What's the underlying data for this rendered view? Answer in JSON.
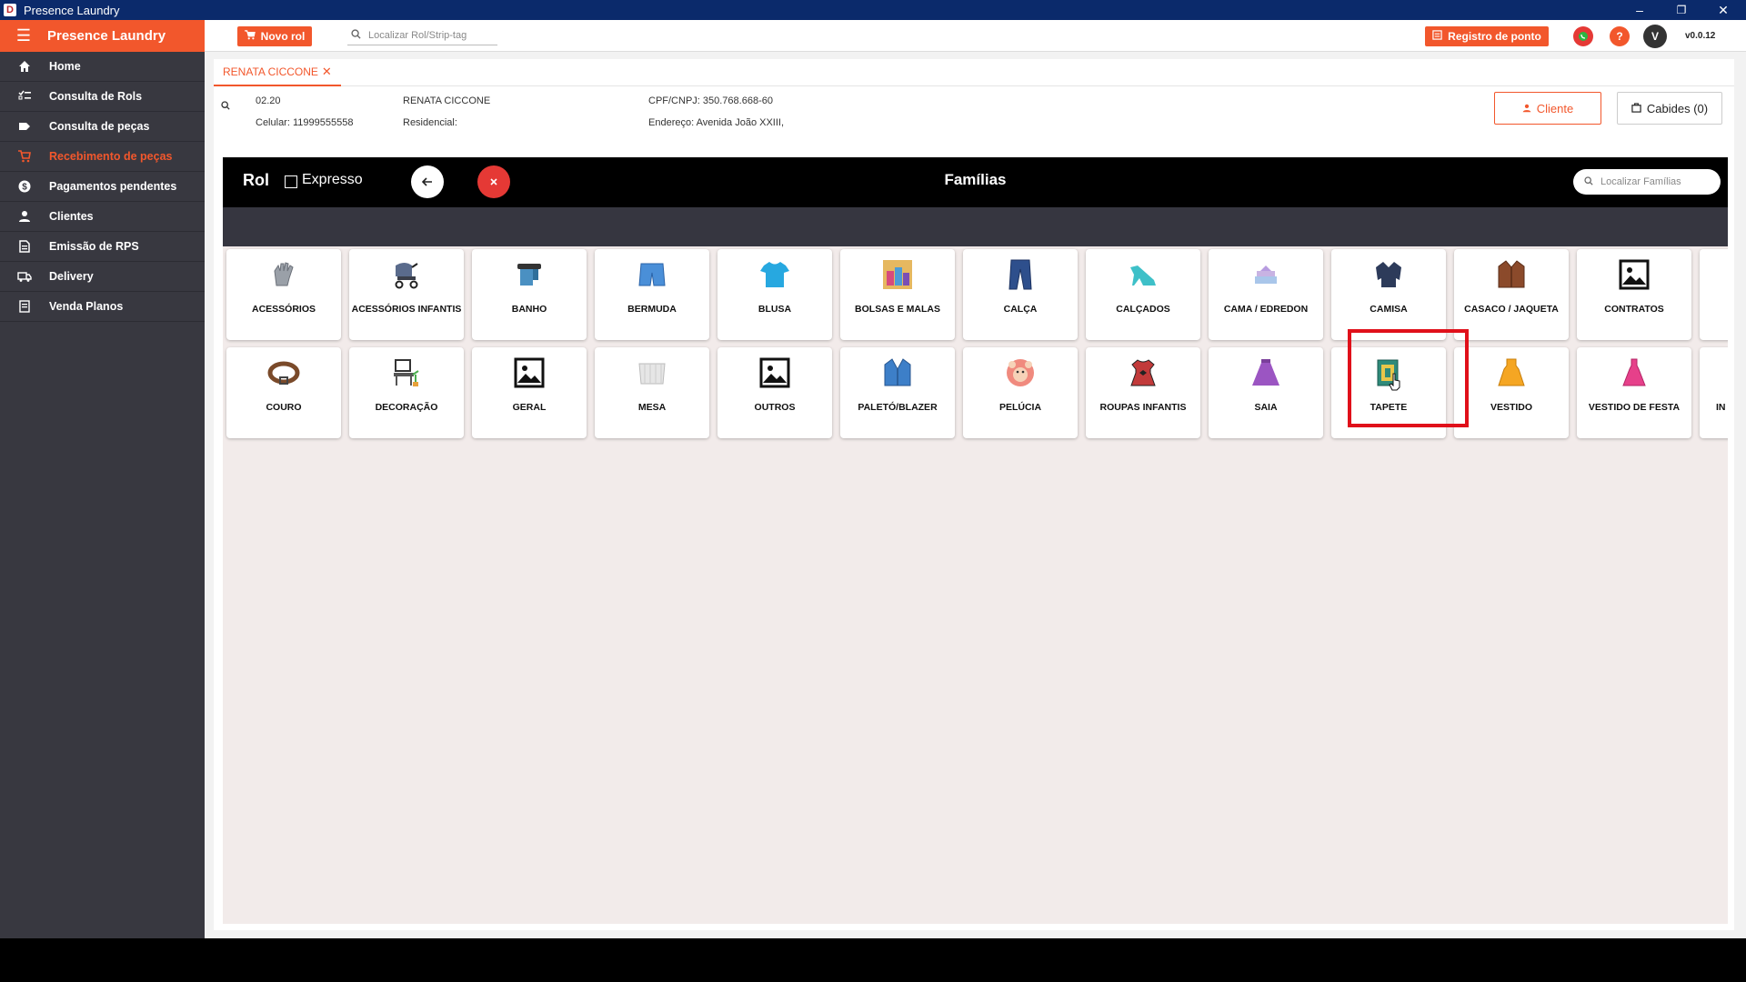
{
  "window": {
    "title": "Presence Laundry",
    "logo_letter": "D",
    "minimize": "–",
    "restore": "❐",
    "close": "✕"
  },
  "sidebar": {
    "brand": "Presence Laundry",
    "items": [
      {
        "label": "Home",
        "icon": "home-icon"
      },
      {
        "label": "Consulta de Rols",
        "icon": "list-check-icon"
      },
      {
        "label": "Consulta de peças",
        "icon": "tag-icon"
      },
      {
        "label": "Recebimento de peças",
        "icon": "cart-icon",
        "active": true
      },
      {
        "label": "Pagamentos pendentes",
        "icon": "dollar-icon"
      },
      {
        "label": "Clientes",
        "icon": "user-icon"
      },
      {
        "label": "Emissão de RPS",
        "icon": "document-icon"
      },
      {
        "label": "Delivery",
        "icon": "truck-icon"
      },
      {
        "label": "Venda Planos",
        "icon": "plan-icon"
      }
    ]
  },
  "topbar": {
    "new_rol": "Novo rol",
    "search_placeholder": "Localizar Rol/Strip-tag",
    "registro_ponto": "Registro de ponto",
    "avatar_letter": "V",
    "version": "v0.0.12"
  },
  "tab": {
    "label": "RENATA CICCONE"
  },
  "client": {
    "code": "02.20",
    "name": "RENATA CICCONE",
    "cpf": "CPF/CNPJ: 350.768.668-60",
    "celular": "Celular: 11999555558",
    "residencial": "Residencial:",
    "endereco": "Endereço: Avenida João XXIII,",
    "cliente_btn": "Cliente",
    "cabides_btn": "Cabides (0)"
  },
  "rol": {
    "title": "Rol",
    "expresso": "Expresso",
    "familias_title": "Famílias",
    "search_placeholder": "Localizar Famílias"
  },
  "families_row1": [
    "ACESSÓRIOS",
    "ACESSÓRIOS INFANTIS",
    "BANHO",
    "BERMUDA",
    "BLUSA",
    "BOLSAS E MALAS",
    "CALÇA",
    "CALÇADOS",
    "CAMA / EDREDON",
    "CAMISA",
    "CASACO / JAQUETA",
    "CONTRATOS",
    ""
  ],
  "families_row2": [
    "COURO",
    "DECORAÇÃO",
    "GERAL",
    "MESA",
    "OUTROS",
    "PALETÓ/BLAZER",
    "PELÚCIA",
    "ROUPAS INFANTIS",
    "SAIA",
    "TAPETE",
    "VESTIDO",
    "VESTIDO DE FESTA",
    "IN"
  ],
  "colors": {
    "accent": "#f2572c",
    "sidebar": "#383840",
    "highlight": "#e0101a"
  }
}
